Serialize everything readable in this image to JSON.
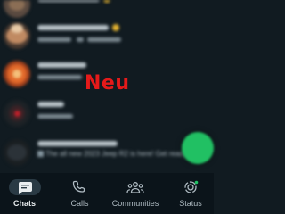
{
  "overlay": {
    "label": "Neu"
  },
  "chat_list": {
    "last_preview": "The all new 2023 Jeep R2 is here! Get ready"
  },
  "bottom_nav": {
    "items": [
      {
        "label": "Chats",
        "icon": "chat-icon",
        "active": true
      },
      {
        "label": "Calls",
        "icon": "phone-icon",
        "active": false
      },
      {
        "label": "Communities",
        "icon": "communities-icon",
        "active": false
      },
      {
        "label": "Status",
        "icon": "status-icon",
        "active": false,
        "has_badge": true
      }
    ]
  },
  "colors": {
    "background": "#111b21",
    "nav_background": "#0b141a",
    "accent_green": "#21c063",
    "overlay_red": "#e51a1a",
    "active_pill": "#2a3a44"
  }
}
